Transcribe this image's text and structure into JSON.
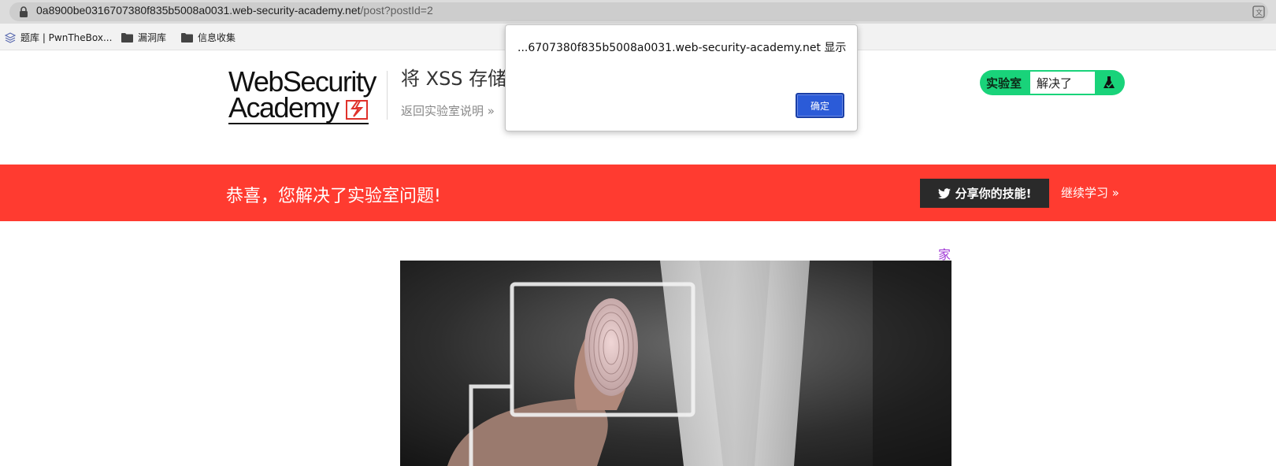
{
  "browser": {
    "url_host": "0a8900be0316707380f835b5008a0031.web-security-academy.net",
    "url_path": "/post?postId=2"
  },
  "bookmarks": [
    {
      "label": "题库 | PwnTheBox..."
    },
    {
      "label": "漏洞库"
    },
    {
      "label": "信息收集"
    }
  ],
  "header": {
    "logo_line1": "WebSecurity",
    "logo_line2": "Academy",
    "lab_title": "将 XSS 存储",
    "back_link": "返回实验室说明 »"
  },
  "lab_status": {
    "label": "实验室",
    "state": "解决了"
  },
  "alert": {
    "message": "...6707380f835b5008a0031.web-security-academy.net 显示",
    "ok_label": "确定"
  },
  "banner": {
    "text": "恭喜，您解决了实验室问题!",
    "share_label": "分享你的技能!",
    "continue_label": "继续学习 »"
  },
  "content": {
    "home_link": "家"
  },
  "colors": {
    "banner_red": "#ff3b30",
    "status_green": "#19d37a",
    "ok_blue": "#2b5bd8",
    "link_purple": "#a23cd6"
  }
}
